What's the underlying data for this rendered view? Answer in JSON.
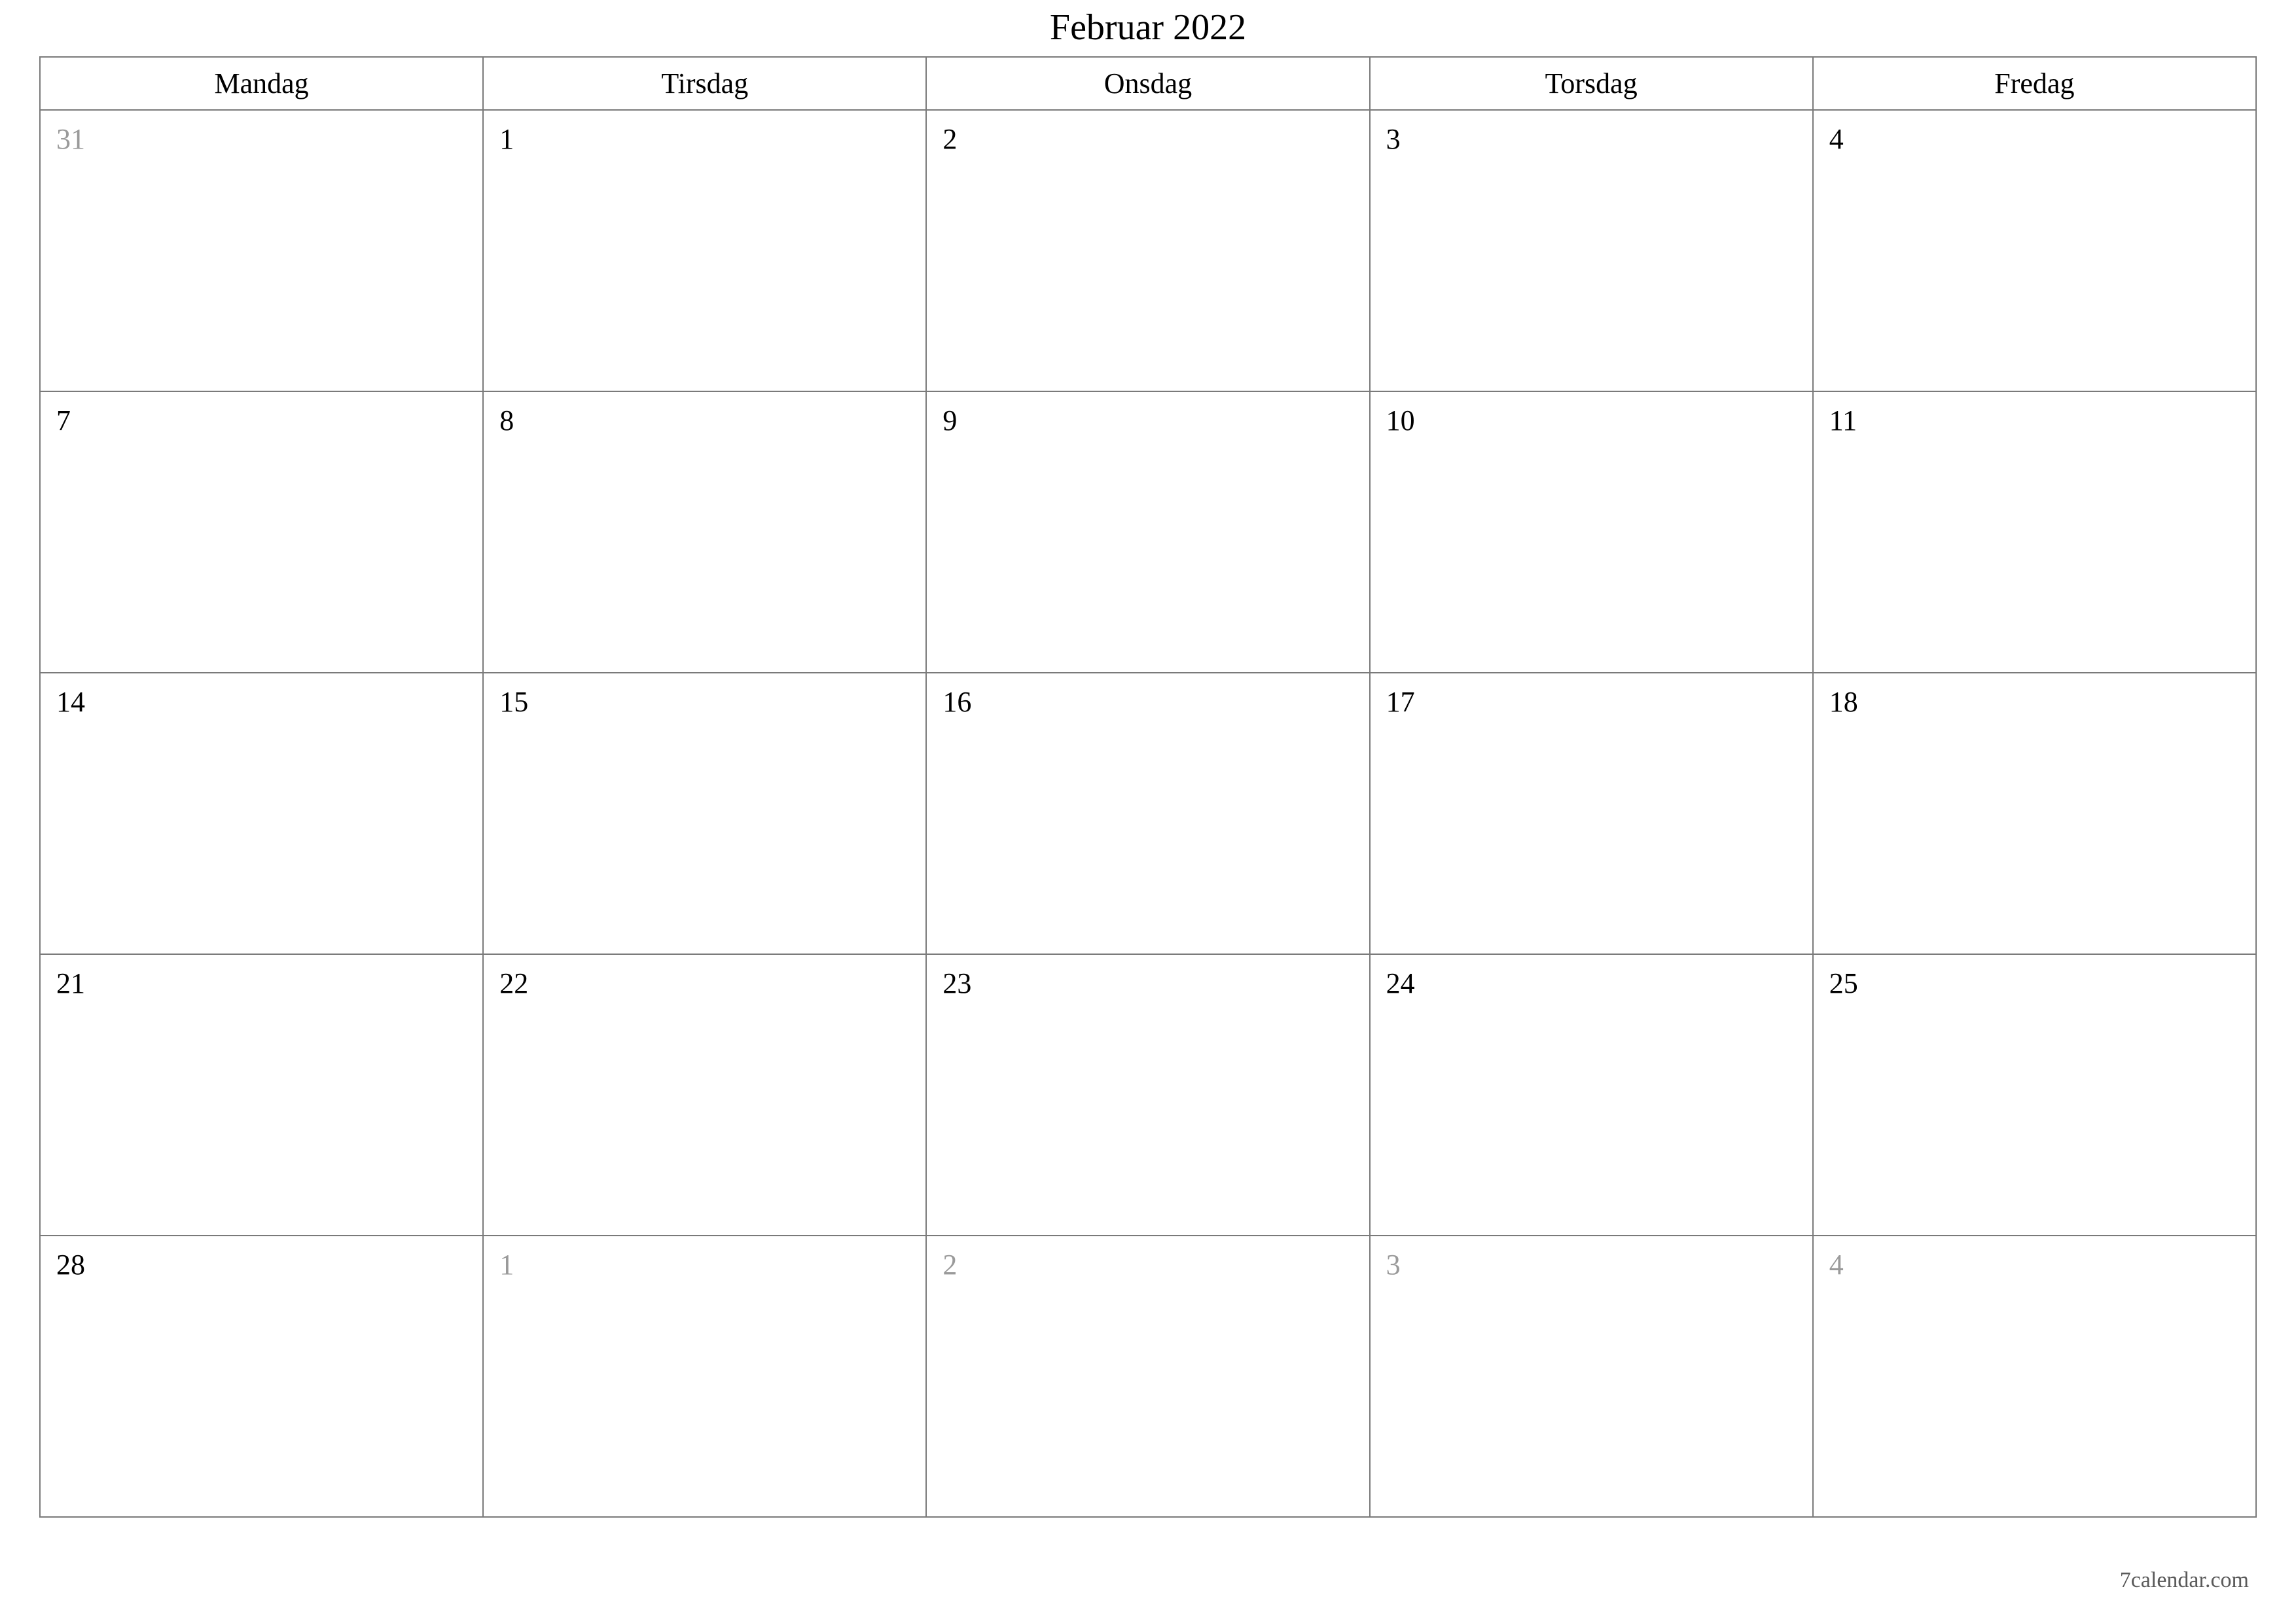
{
  "title": "Februar 2022",
  "weekdays": [
    "Mandag",
    "Tirsdag",
    "Onsdag",
    "Torsdag",
    "Fredag"
  ],
  "weeks": [
    [
      {
        "day": "31",
        "out": true
      },
      {
        "day": "1",
        "out": false
      },
      {
        "day": "2",
        "out": false
      },
      {
        "day": "3",
        "out": false
      },
      {
        "day": "4",
        "out": false
      }
    ],
    [
      {
        "day": "7",
        "out": false
      },
      {
        "day": "8",
        "out": false
      },
      {
        "day": "9",
        "out": false
      },
      {
        "day": "10",
        "out": false
      },
      {
        "day": "11",
        "out": false
      }
    ],
    [
      {
        "day": "14",
        "out": false
      },
      {
        "day": "15",
        "out": false
      },
      {
        "day": "16",
        "out": false
      },
      {
        "day": "17",
        "out": false
      },
      {
        "day": "18",
        "out": false
      }
    ],
    [
      {
        "day": "21",
        "out": false
      },
      {
        "day": "22",
        "out": false
      },
      {
        "day": "23",
        "out": false
      },
      {
        "day": "24",
        "out": false
      },
      {
        "day": "25",
        "out": false
      }
    ],
    [
      {
        "day": "28",
        "out": false
      },
      {
        "day": "1",
        "out": true
      },
      {
        "day": "2",
        "out": true
      },
      {
        "day": "3",
        "out": true
      },
      {
        "day": "4",
        "out": true
      }
    ]
  ],
  "footer": "7calendar.com"
}
